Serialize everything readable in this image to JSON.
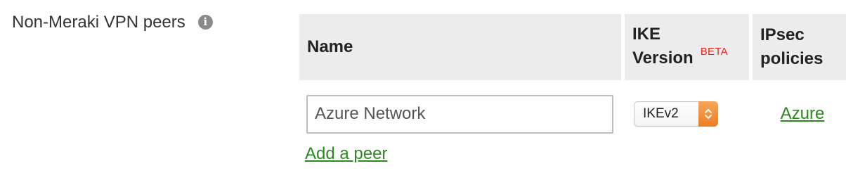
{
  "section": {
    "label": "Non-Meraki VPN peers",
    "info_icon": "info-icon"
  },
  "table": {
    "headers": {
      "name": "Name",
      "ike_line1": "IKE",
      "ike_line2": "Version",
      "beta": "BETA",
      "ipsec_line1": "IPsec",
      "ipsec_line2": "policies"
    },
    "rows": [
      {
        "name_value": "Azure Network",
        "ike_version": "IKEv2",
        "ipsec_policy": "Azure"
      }
    ]
  },
  "actions": {
    "add_peer": "Add a peer"
  },
  "colors": {
    "link": "#2a8a1e",
    "beta": "#e8261e",
    "header_bg": "#ececec",
    "select_accent": "#ee7d1f"
  }
}
